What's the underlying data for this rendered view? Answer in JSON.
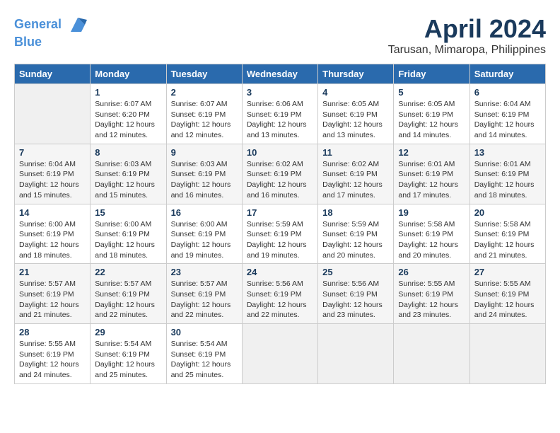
{
  "header": {
    "logo_line1": "General",
    "logo_line2": "Blue",
    "month": "April 2024",
    "location": "Tarusan, Mimaropa, Philippines"
  },
  "weekdays": [
    "Sunday",
    "Monday",
    "Tuesday",
    "Wednesday",
    "Thursday",
    "Friday",
    "Saturday"
  ],
  "weeks": [
    [
      {
        "day": "",
        "info": ""
      },
      {
        "day": "1",
        "info": "Sunrise: 6:07 AM\nSunset: 6:20 PM\nDaylight: 12 hours\nand 12 minutes."
      },
      {
        "day": "2",
        "info": "Sunrise: 6:07 AM\nSunset: 6:19 PM\nDaylight: 12 hours\nand 12 minutes."
      },
      {
        "day": "3",
        "info": "Sunrise: 6:06 AM\nSunset: 6:19 PM\nDaylight: 12 hours\nand 13 minutes."
      },
      {
        "day": "4",
        "info": "Sunrise: 6:05 AM\nSunset: 6:19 PM\nDaylight: 12 hours\nand 13 minutes."
      },
      {
        "day": "5",
        "info": "Sunrise: 6:05 AM\nSunset: 6:19 PM\nDaylight: 12 hours\nand 14 minutes."
      },
      {
        "day": "6",
        "info": "Sunrise: 6:04 AM\nSunset: 6:19 PM\nDaylight: 12 hours\nand 14 minutes."
      }
    ],
    [
      {
        "day": "7",
        "info": "Sunrise: 6:04 AM\nSunset: 6:19 PM\nDaylight: 12 hours\nand 15 minutes."
      },
      {
        "day": "8",
        "info": "Sunrise: 6:03 AM\nSunset: 6:19 PM\nDaylight: 12 hours\nand 15 minutes."
      },
      {
        "day": "9",
        "info": "Sunrise: 6:03 AM\nSunset: 6:19 PM\nDaylight: 12 hours\nand 16 minutes."
      },
      {
        "day": "10",
        "info": "Sunrise: 6:02 AM\nSunset: 6:19 PM\nDaylight: 12 hours\nand 16 minutes."
      },
      {
        "day": "11",
        "info": "Sunrise: 6:02 AM\nSunset: 6:19 PM\nDaylight: 12 hours\nand 17 minutes."
      },
      {
        "day": "12",
        "info": "Sunrise: 6:01 AM\nSunset: 6:19 PM\nDaylight: 12 hours\nand 17 minutes."
      },
      {
        "day": "13",
        "info": "Sunrise: 6:01 AM\nSunset: 6:19 PM\nDaylight: 12 hours\nand 18 minutes."
      }
    ],
    [
      {
        "day": "14",
        "info": "Sunrise: 6:00 AM\nSunset: 6:19 PM\nDaylight: 12 hours\nand 18 minutes."
      },
      {
        "day": "15",
        "info": "Sunrise: 6:00 AM\nSunset: 6:19 PM\nDaylight: 12 hours\nand 18 minutes."
      },
      {
        "day": "16",
        "info": "Sunrise: 6:00 AM\nSunset: 6:19 PM\nDaylight: 12 hours\nand 19 minutes."
      },
      {
        "day": "17",
        "info": "Sunrise: 5:59 AM\nSunset: 6:19 PM\nDaylight: 12 hours\nand 19 minutes."
      },
      {
        "day": "18",
        "info": "Sunrise: 5:59 AM\nSunset: 6:19 PM\nDaylight: 12 hours\nand 20 minutes."
      },
      {
        "day": "19",
        "info": "Sunrise: 5:58 AM\nSunset: 6:19 PM\nDaylight: 12 hours\nand 20 minutes."
      },
      {
        "day": "20",
        "info": "Sunrise: 5:58 AM\nSunset: 6:19 PM\nDaylight: 12 hours\nand 21 minutes."
      }
    ],
    [
      {
        "day": "21",
        "info": "Sunrise: 5:57 AM\nSunset: 6:19 PM\nDaylight: 12 hours\nand 21 minutes."
      },
      {
        "day": "22",
        "info": "Sunrise: 5:57 AM\nSunset: 6:19 PM\nDaylight: 12 hours\nand 22 minutes."
      },
      {
        "day": "23",
        "info": "Sunrise: 5:57 AM\nSunset: 6:19 PM\nDaylight: 12 hours\nand 22 minutes."
      },
      {
        "day": "24",
        "info": "Sunrise: 5:56 AM\nSunset: 6:19 PM\nDaylight: 12 hours\nand 22 minutes."
      },
      {
        "day": "25",
        "info": "Sunrise: 5:56 AM\nSunset: 6:19 PM\nDaylight: 12 hours\nand 23 minutes."
      },
      {
        "day": "26",
        "info": "Sunrise: 5:55 AM\nSunset: 6:19 PM\nDaylight: 12 hours\nand 23 minutes."
      },
      {
        "day": "27",
        "info": "Sunrise: 5:55 AM\nSunset: 6:19 PM\nDaylight: 12 hours\nand 24 minutes."
      }
    ],
    [
      {
        "day": "28",
        "info": "Sunrise: 5:55 AM\nSunset: 6:19 PM\nDaylight: 12 hours\nand 24 minutes."
      },
      {
        "day": "29",
        "info": "Sunrise: 5:54 AM\nSunset: 6:19 PM\nDaylight: 12 hours\nand 25 minutes."
      },
      {
        "day": "30",
        "info": "Sunrise: 5:54 AM\nSunset: 6:19 PM\nDaylight: 12 hours\nand 25 minutes."
      },
      {
        "day": "",
        "info": ""
      },
      {
        "day": "",
        "info": ""
      },
      {
        "day": "",
        "info": ""
      },
      {
        "day": "",
        "info": ""
      }
    ]
  ]
}
